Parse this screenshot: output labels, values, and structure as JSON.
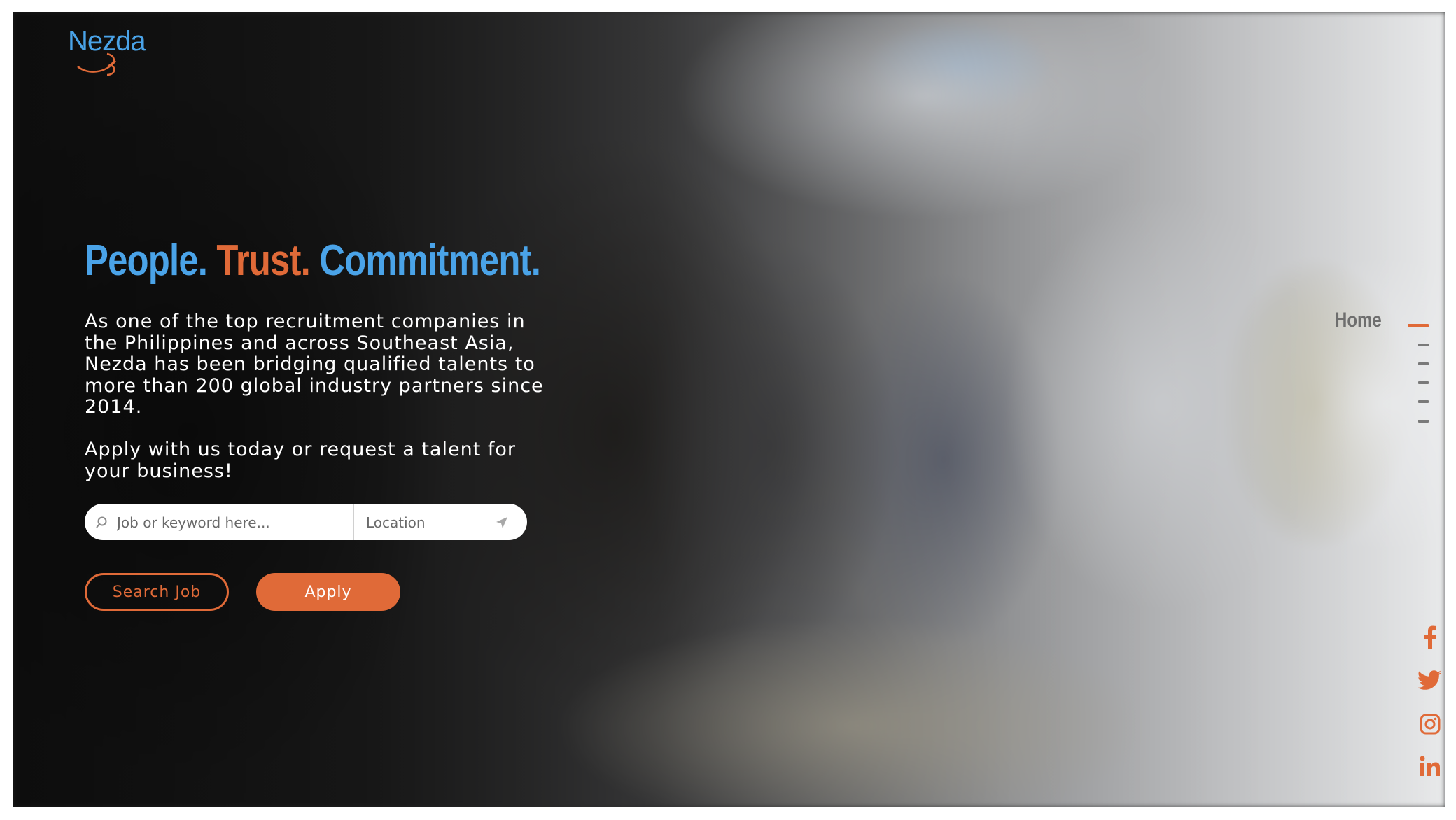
{
  "brand": {
    "logo_text": "Nezda",
    "accent_orange": "#e06a38",
    "accent_blue": "#4aa3e8"
  },
  "hero": {
    "headline_part1": "People.",
    "headline_part2": "Trust.",
    "headline_part3": "Commitment.",
    "paragraph1": "As one of the top recruitment companies in the Philippines and across Southeast Asia, Nezda has been bridging qualified talents to more than 200 global industry partners since 2014.",
    "paragraph2": "Apply with us today or request a talent for your business!"
  },
  "search": {
    "keyword_placeholder": "Job or keyword here...",
    "location_placeholder": "Location",
    "search_icon": "search-icon",
    "location_icon": "location-arrow-icon"
  },
  "buttons": {
    "search_job": "Search Job",
    "apply": "Apply"
  },
  "section_nav": {
    "active_label": "Home",
    "item_count_visible": 6
  },
  "social": [
    {
      "icon": "facebook-icon"
    },
    {
      "icon": "twitter-icon"
    },
    {
      "icon": "instagram-icon"
    },
    {
      "icon": "linkedin-icon"
    }
  ]
}
